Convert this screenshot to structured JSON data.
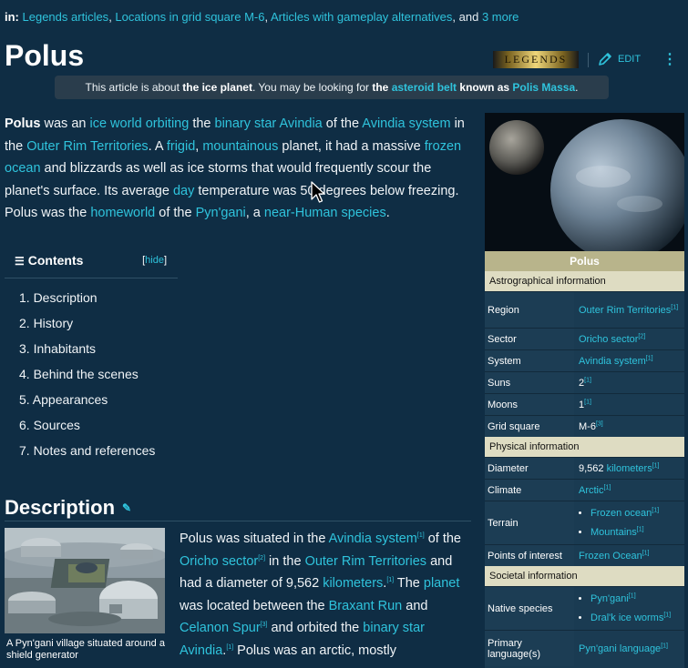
{
  "categories": {
    "prefix": "in:",
    "links": [
      "Legends articles",
      "Locations in grid square M-6",
      "Articles with gameplay alternatives"
    ],
    "and": ", and",
    "more": "3 more"
  },
  "article": {
    "title": "Polus",
    "badge": "LEGENDS",
    "edit_label": "EDIT"
  },
  "hatnote": {
    "t1": "This article is about ",
    "b1": "the ice planet",
    "t2": ". You may be looking for ",
    "b2": "the ",
    "l1": "asteroid belt",
    "b3": " known as ",
    "l2": "Polis Massa",
    "t3": "."
  },
  "lead": {
    "p": [
      {
        "b": "Polus"
      },
      {
        "t": " was an "
      },
      {
        "a": "ice world"
      },
      {
        "t": " "
      },
      {
        "a": "orbiting"
      },
      {
        "t": " the "
      },
      {
        "a": "binary star"
      },
      {
        "t": " "
      },
      {
        "a": "Avindia"
      },
      {
        "t": " of the "
      },
      {
        "a": "Avindia system"
      },
      {
        "t": " in the "
      },
      {
        "a": "Outer Rim Territories"
      },
      {
        "t": ". A "
      },
      {
        "a": "frigid"
      },
      {
        "t": ", "
      },
      {
        "a": "mountainous"
      },
      {
        "t": " planet, it had a massive "
      },
      {
        "a": "frozen ocean"
      },
      {
        "t": " and blizzards as well as ice storms that would frequently scour the planet's surface. Its average "
      },
      {
        "a": "day"
      },
      {
        "t": " temperature was 50 degrees below freezing. Polus was the "
      },
      {
        "a": "homeworld"
      },
      {
        "t": " of the "
      },
      {
        "a": "Pyn'gani"
      },
      {
        "t": ", a "
      },
      {
        "a": "near-Human species"
      },
      {
        "t": "."
      }
    ]
  },
  "toc": {
    "title": "Contents",
    "hide_open": "[",
    "hide": "hide",
    "hide_close": "]",
    "items": [
      "1.  Description",
      "2.  History",
      "3.  Inhabitants",
      "4.  Behind the scenes",
      "5.  Appearances",
      "6.  Sources",
      "7.  Notes and references"
    ]
  },
  "section": {
    "heading": "Description",
    "thumb_caption": "A Pyn'gani village situated around a shield generator",
    "p": [
      {
        "t": "Polus was situated in the "
      },
      {
        "a": "Avindia system"
      },
      {
        "s": "[1]"
      },
      {
        "t": " of the "
      },
      {
        "a": "Oricho sector"
      },
      {
        "s": "[2]"
      },
      {
        "t": " in the "
      },
      {
        "a": "Outer Rim Territories"
      },
      {
        "t": " and had a diameter of 9,562 "
      },
      {
        "a": "kilometers"
      },
      {
        "t": "."
      },
      {
        "s": "[1]"
      },
      {
        "t": " The "
      },
      {
        "a": "planet"
      },
      {
        "t": " was located between the "
      },
      {
        "a": "Braxant Run"
      },
      {
        "t": " and "
      },
      {
        "a": "Celanon Spur"
      },
      {
        "s": "[3]"
      },
      {
        "t": " and orbited the "
      },
      {
        "a": "binary star Avindia"
      },
      {
        "t": "."
      },
      {
        "s": "[1]"
      },
      {
        "t": " Polus was an arctic, mostly"
      }
    ]
  },
  "infobox": {
    "title": "Polus",
    "sections": [
      {
        "label": "Astrographical information",
        "rows": [
          {
            "k": "Region",
            "v": [
              {
                "a": "Outer Rim Territories",
                "s": "[1]"
              }
            ],
            "h": 40
          },
          {
            "k": "Sector",
            "v": [
              {
                "a": "Oricho sector",
                "s": "[2]"
              }
            ],
            "h": 24
          },
          {
            "k": "System",
            "v": [
              {
                "a": "Avindia system",
                "s": "[1]"
              }
            ],
            "h": 24
          },
          {
            "k": "Suns",
            "v": [
              {
                "t": "2",
                "s": "[1]"
              }
            ],
            "h": 24
          },
          {
            "k": "Moons",
            "v": [
              {
                "t": "1",
                "s": "[1]"
              }
            ],
            "h": 24
          },
          {
            "k": "Grid square",
            "v": [
              {
                "t": "M-6",
                "s": "[3]"
              }
            ],
            "h": 24
          }
        ]
      },
      {
        "label": "Physical information",
        "rows": [
          {
            "k": "Diameter",
            "v": [
              {
                "t": "9,562 ",
                "a": "kilometers",
                "s": "[1]"
              }
            ],
            "h": 24
          },
          {
            "k": "Climate",
            "v": [
              {
                "a": "Arctic",
                "s": "[1]"
              }
            ],
            "h": 24
          },
          {
            "k": "Terrain",
            "list": [
              {
                "a": "Frozen ocean",
                "s": "[1]"
              },
              {
                "a": "Mountains",
                "s": "[1]"
              }
            ],
            "h": 48
          },
          {
            "k": "Points of interest",
            "v": [
              {
                "a": "Frozen Ocean",
                "s": "[1]"
              }
            ],
            "h": 24
          }
        ]
      },
      {
        "label": "Societal information",
        "rows": [
          {
            "k": "Native species",
            "list": [
              {
                "a": "Pyn'gani",
                "s": "[1]"
              },
              {
                "a": "Dral'k ice worms",
                "s": "[1]"
              }
            ],
            "h": 48
          },
          {
            "k": "Primary language(s)",
            "v": [
              {
                "a": "Pyn'gani language",
                "s": "[1]"
              }
            ],
            "h": 40
          }
        ]
      }
    ]
  },
  "colors": {
    "background": "#0f2d44",
    "link": "#2fc3dc",
    "infobox_header": "#b8b48b",
    "infobox_section": "#dedcc2"
  }
}
